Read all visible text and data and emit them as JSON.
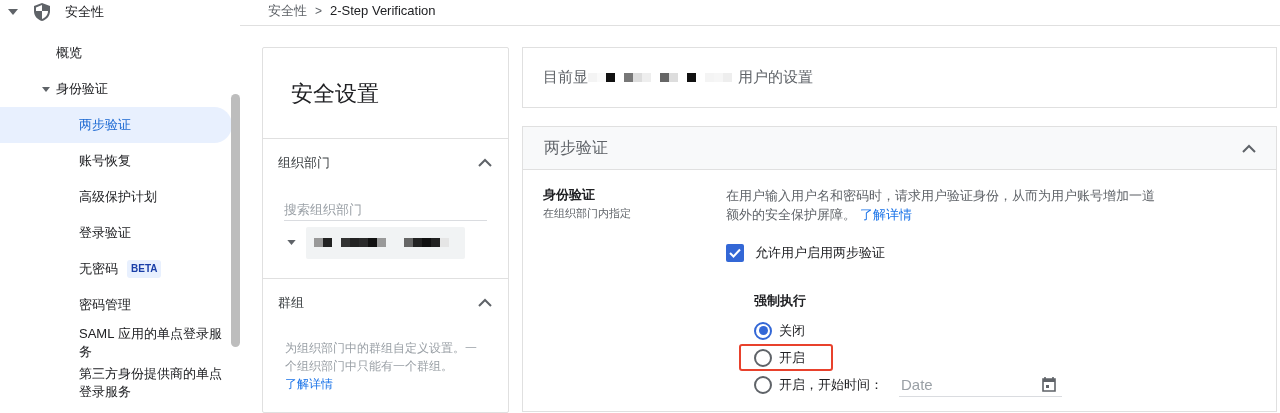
{
  "sidebar": {
    "section": {
      "label": "安全性",
      "expanded": true
    },
    "items": [
      {
        "label": "概览",
        "selected": false
      },
      {
        "label": "身份验证",
        "selected": false,
        "expanded": true,
        "children": [
          {
            "label": "两步验证",
            "selected": true
          },
          {
            "label": "账号恢复",
            "selected": false
          },
          {
            "label": "高级保护计划",
            "selected": false
          },
          {
            "label": "登录验证",
            "selected": false
          },
          {
            "label": "无密码",
            "selected": false,
            "badge": "BETA"
          },
          {
            "label": "密码管理",
            "selected": false
          },
          {
            "label": "SAML 应用的单点登录服务",
            "selected": false
          },
          {
            "label": "第三方身份提供商的单点登录服务",
            "selected": false
          }
        ]
      }
    ]
  },
  "breadcrumb": {
    "items": [
      "安全性",
      "2-Step Verification"
    ],
    "separator": ">"
  },
  "settings_panel": {
    "title": "安全设置",
    "org_units": {
      "title": "组织部门",
      "expanded": true,
      "search_placeholder": "搜索组织部门"
    },
    "groups": {
      "title": "群组",
      "expanded": true,
      "description": "为组织部门中的群组自定义设置。一个组织部门中只能有一个群组。",
      "link": "了解详情"
    }
  },
  "current_banner": {
    "prefix": "目前显",
    "suffix": "用户的设置"
  },
  "two_step": {
    "title": "两步验证",
    "expanded": true,
    "setting_label": "身份验证",
    "setting_sublabel": "在组织部门内指定",
    "description": "在用户输入用户名和密码时，请求用户验证身份，从而为用户账号增加一道额外的安全保护屏障。",
    "link": "了解详情",
    "allow_checkbox": {
      "label": "允许用户启用两步验证",
      "checked": true
    },
    "enforcement": {
      "title": "强制执行",
      "options": [
        {
          "label": "关闭",
          "selected": true,
          "highlighted": false
        },
        {
          "label": "开启",
          "selected": false,
          "highlighted": true
        },
        {
          "label": "开启，开始时间：",
          "selected": false,
          "highlighted": false,
          "date_placeholder": "Date"
        }
      ]
    }
  }
}
